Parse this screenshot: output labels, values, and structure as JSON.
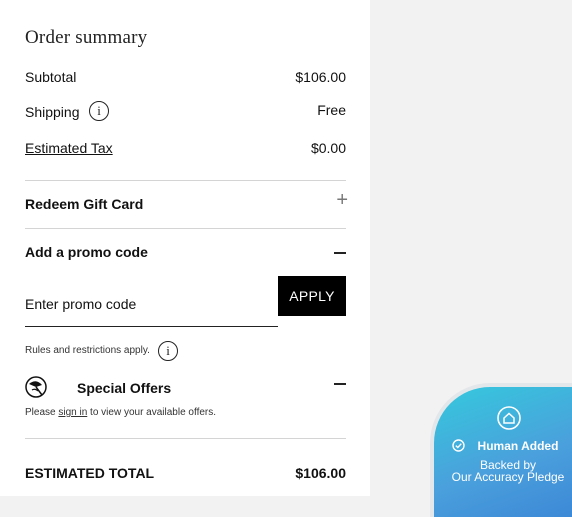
{
  "summary": {
    "title": "Order summary",
    "subtotal_label": "Subtotal",
    "subtotal_value": "$106.00",
    "shipping_label": "Shipping",
    "shipping_value": "Free",
    "tax_label": "Estimated Tax",
    "tax_value": "$0.00"
  },
  "gift_card": {
    "label": "Redeem Gift Card",
    "toggle": "+"
  },
  "promo": {
    "label": "Add a promo code",
    "placeholder": "Enter promo code",
    "apply_label": "APPLY",
    "rules_text": "Rules and restrictions apply."
  },
  "offers": {
    "label": "Special Offers",
    "please": "Please ",
    "sign_in": "sign in",
    "rest": " to view your available offers."
  },
  "total": {
    "label": "ESTIMATED TOTAL",
    "value": "$106.00"
  },
  "badge": {
    "title": "Human Added",
    "line1": "Backed by",
    "line2": "Our Accuracy Pledge",
    "colors": {
      "gradient_start": "#35c9dd",
      "gradient_end": "#3b86d6"
    }
  },
  "icons": {
    "info": "i",
    "check": "check-circle-icon",
    "home": "home-badge-icon",
    "offers": "beach-umbrella-icon"
  }
}
